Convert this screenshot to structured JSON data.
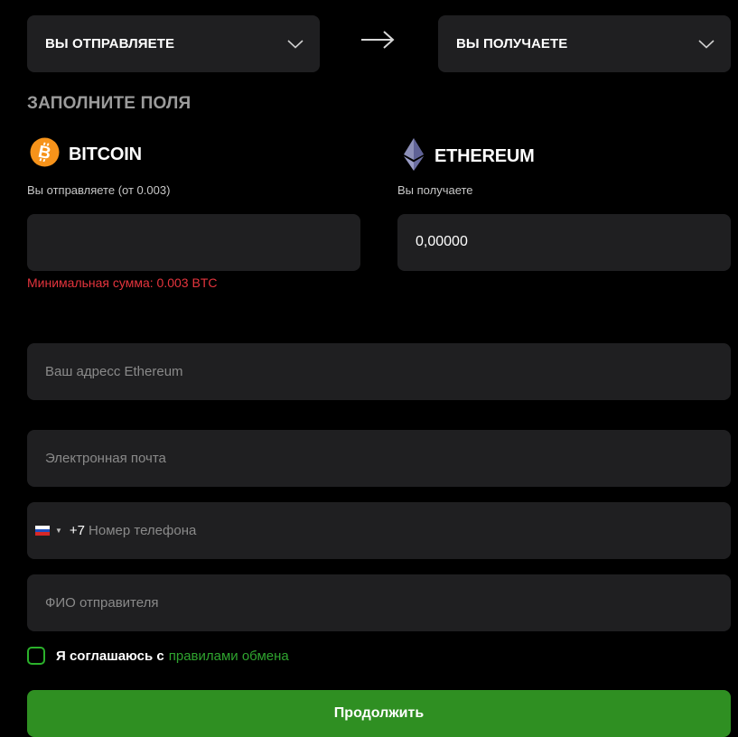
{
  "selectors": {
    "send_label": "ВЫ ОТПРАВЛЯЕТЕ",
    "receive_label": "ВЫ ПОЛУЧАЕТЕ"
  },
  "section_title": "ЗАПОЛНИТЕ ПОЛЯ",
  "send": {
    "coin_name": "BITCOIN",
    "coin_icon": "bitcoin-icon",
    "sublabel": "Вы отправляете (от 0.003)",
    "amount_value": "",
    "error": "Минимальная сумма: 0.003 BTC"
  },
  "receive": {
    "coin_name": "ETHEREUM",
    "coin_icon": "ethereum-icon",
    "sublabel": "Вы получаете",
    "amount_value": "0,00000"
  },
  "form": {
    "address_placeholder": "Ваш адресс Ethereum",
    "email_placeholder": "Электронная почта",
    "phone_code": "+7",
    "phone_placeholder": "Номер телефона",
    "name_placeholder": "ФИО отправителя"
  },
  "agreement": {
    "text": "Я соглашаюсь с",
    "link": "правилами обмена"
  },
  "continue_label": "Продолжить",
  "colors": {
    "background": "#000000",
    "panel": "#1f1f21",
    "accent_green": "#2f8f22",
    "link_green": "#2fa42f",
    "error_red": "#e5343d",
    "bitcoin_orange": "#f7931a"
  }
}
